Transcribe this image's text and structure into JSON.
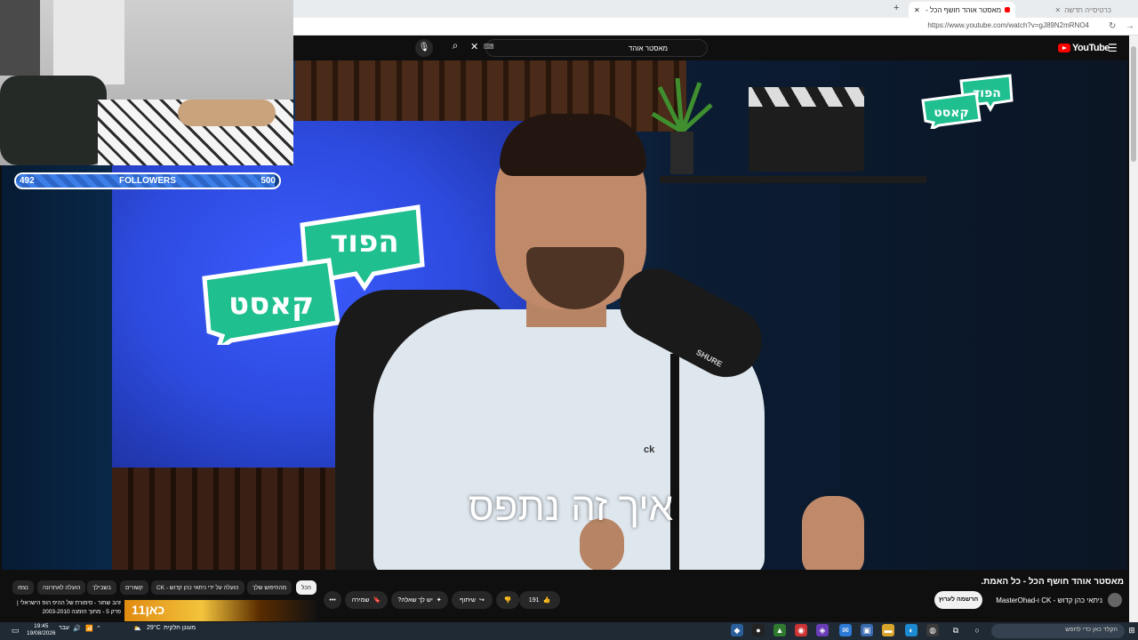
{
  "browser": {
    "tabs": [
      {
        "label": "מאסטר אוהד חושף הכל - כל האמת",
        "active": true
      },
      {
        "label": "כרטיסייה חדשה",
        "active": false
      }
    ],
    "new_tab_label": "+",
    "url": "https://www.youtube.com/watch?v=gJ89N2mRNO4"
  },
  "youtube": {
    "logo_text": "YouTube",
    "search_value": "מאסטר אוהד",
    "brand_color": "#ff0000"
  },
  "video": {
    "subtitle": "איך זה נתפס",
    "shirt_logo": "ck",
    "mic_brand": "SHURE",
    "corner_logo_line1": "הפוד",
    "corner_logo_line2": "קאסט",
    "screen_logo_line1": "הפוד",
    "screen_logo_line2": "קאסט"
  },
  "followers": {
    "current": "492",
    "label": "FOLLOWERS",
    "goal": "500",
    "progress": 0.984
  },
  "watch": {
    "title": "מאסטר אוהד חושף הכל - כל האמת.",
    "channel": "ניתאי כהן קדוש - CK ו-MasterOhad",
    "subscribe": "הרשמה לערוץ",
    "likes": "191",
    "share": "שיתוף",
    "ask": "יש לך שאלה?",
    "save": "שמירה",
    "more": "•••"
  },
  "chips": [
    "הכל",
    "מהחיפוש שלך",
    "הועלה על ידי ניתאי כהן קדוש - CK",
    "קשורים",
    "בשבילך",
    "הועלה לאחרונה",
    "נצפו"
  ],
  "recommendation": {
    "title": "זהב שחור - סימורת של ההיפ הופ הישראלי | פרק 5 - מתוך הזמנה 2003-2010",
    "thumb_text": "כאן11"
  },
  "taskbar": {
    "weather_temp": "29°C",
    "weather_text": "מעונן חלקית",
    "lang": "עבר",
    "time": "19:45",
    "date": "19/08/2026",
    "search_placeholder": "הקלד כאן כדי לחפש"
  }
}
